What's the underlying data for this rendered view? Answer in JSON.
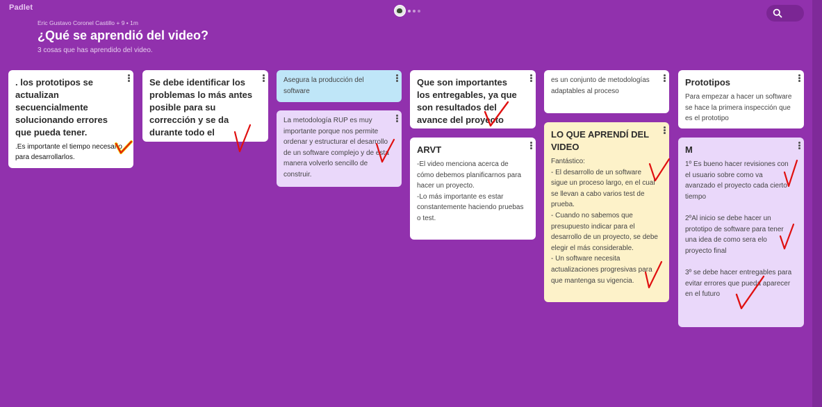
{
  "app": {
    "logo": "Padlet"
  },
  "header": {
    "meta": "Eric Gustavo Coronel Castillo  + 9  • 1m",
    "title": "¿Qué se aprendió del video?",
    "subtitle": "3 cosas que has aprendido del video."
  },
  "posts": [
    {
      "title": ". los prototipos se actualizan secuencialmente solucionando errores que pueda tener.",
      "body": ".Es importante el tiempo necesario para desarrollarlos."
    },
    {
      "title": "Se debe identificar los problemas lo más antes posible para su corrección y se da durante todo el proyecto.",
      "body": ""
    },
    {
      "title": "",
      "body": "Asegura la producción del software"
    },
    {
      "title": "",
      "body": "La metodología RUP es muy importante porque nos permite ordenar y estructurar el desarrollo de un software complejo y de esta manera volverlo sencillo de construir."
    },
    {
      "title": "Que son importantes los entregables, ya que son resultados del avance del proyecto",
      "body": ""
    },
    {
      "title": "ARVT",
      "body": "-El video menciona acerca de cómo debemos planificarnos para hacer un proyecto.\n-Lo más  importante es estar constantemente haciendo pruebas o test."
    },
    {
      "title": "",
      "body": "es un conjunto de metodologías adaptables al proceso"
    },
    {
      "title": "LO QUE APRENDÍ DEL VIDEO",
      "body": "Fantástico:\n- El desarrollo de un software sigue un proceso largo, en el cual se llevan a cabo varios test de prueba.\n- Cuando no sabemos que presupuesto indicar para el desarrollo de un proyecto, se debe elegir el más considerable.\n- Un software necesita actualizaciones progresivas para que mantenga su vigencia."
    },
    {
      "title": "Prototipos",
      "body": "Para empezar a hacer un software se hace la primera inspección que es el prototipo"
    },
    {
      "title": "M",
      "body": "1º Es bueno hacer revisiones con el usuario sobre como va avanzado el proyecto cada cierto tiempo\n\n2ºAl inicio se debe hacer un prototipo de software para tener una idea de como sera elo proyecto final\n\n3º se debe hacer entregables para evitar errores que pueda aparecer\n en el futuro"
    }
  ],
  "colors": {
    "background": "#9131ad",
    "card_default": "#ffffff",
    "card_blue": "#bfe6f8",
    "card_lilac": "#ead8fa",
    "card_cream": "#fdf2c9",
    "check_marks": "#e01010"
  },
  "icons": {
    "search": "search-icon",
    "more": "more-options-icon",
    "avatar": "collaborator-avatar"
  }
}
